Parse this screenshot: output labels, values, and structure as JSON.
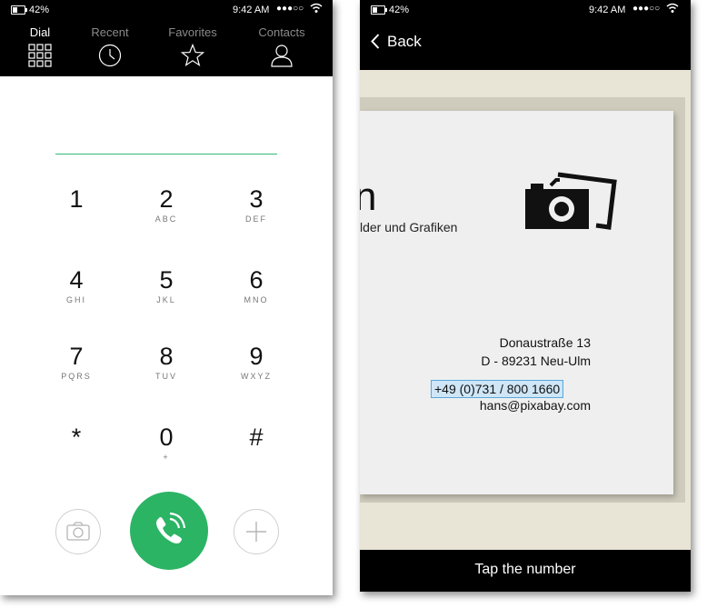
{
  "dialer": {
    "status": {
      "battery": "42%",
      "time": "9:42 AM",
      "signal": "●●●○○"
    },
    "tabs": [
      {
        "label": "Dial",
        "icon": "keypad-grid-icon",
        "active": true
      },
      {
        "label": "Recent",
        "icon": "clock-icon",
        "active": false
      },
      {
        "label": "Favorites",
        "icon": "star-icon",
        "active": false
      },
      {
        "label": "Contacts",
        "icon": "person-icon",
        "active": false
      }
    ],
    "number_field": "",
    "keys": [
      {
        "digit": "1",
        "letters": ""
      },
      {
        "digit": "2",
        "letters": "ABC"
      },
      {
        "digit": "3",
        "letters": "DEF"
      },
      {
        "digit": "4",
        "letters": "GHI"
      },
      {
        "digit": "5",
        "letters": "JKL"
      },
      {
        "digit": "6",
        "letters": "MNO"
      },
      {
        "digit": "7",
        "letters": "PQRS"
      },
      {
        "digit": "8",
        "letters": "TUV"
      },
      {
        "digit": "9",
        "letters": "WXYZ"
      },
      {
        "digit": "*",
        "letters": ""
      },
      {
        "digit": "0",
        "letters": "+"
      },
      {
        "digit": "#",
        "letters": ""
      }
    ],
    "actions": {
      "left_icon": "camera-icon",
      "center_icon": "phone-call-icon",
      "right_icon": "plus-icon"
    },
    "accent_color": "#2cb465"
  },
  "scanner": {
    "status": {
      "battery": "42%",
      "time": "9:42 AM",
      "signal": "●●●○○"
    },
    "back_label": "Back",
    "card": {
      "logo_fragment": "n",
      "tagline": "lder und Grafiken",
      "street": "Donaustraße 13",
      "city": "D - 89231 Neu-Ulm",
      "phone": "+49 (0)731 / 800 1660",
      "email": "hans@pixabay.com"
    },
    "hint": "Tap the number",
    "highlight_color": "#57a8dc"
  }
}
